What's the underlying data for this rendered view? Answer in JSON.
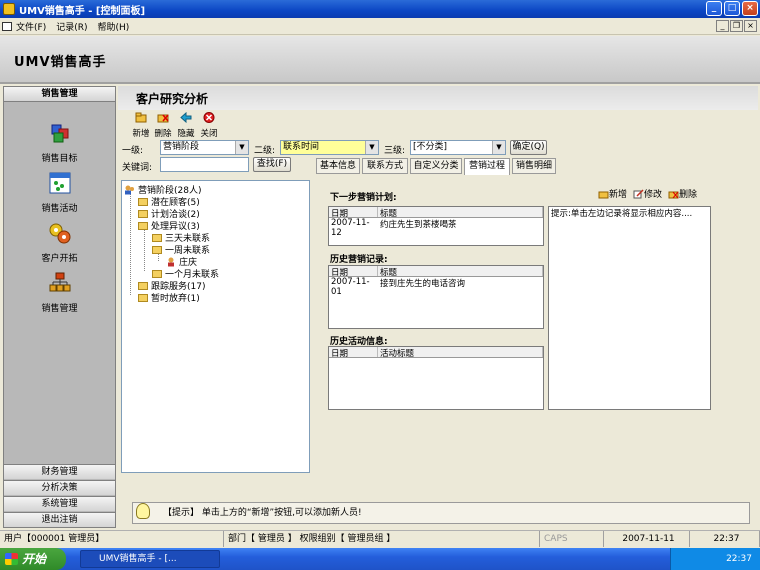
{
  "window": {
    "title": "UMV销售高手 - [控制面板]",
    "min": "_",
    "max": "□",
    "close": "×"
  },
  "menu": [
    "文件(F)",
    "记录(R)",
    "帮助(H)"
  ],
  "mdi": {
    "min": "_",
    "restore": "❐",
    "close": "×"
  },
  "brand": "UMV销售高手",
  "nav": {
    "header": "销售管理",
    "items": [
      "销售目标",
      "销售活动",
      "客户开拓",
      "销售管理"
    ],
    "bottom": [
      "财务管理",
      "分析决策",
      "系统管理",
      "退出注销"
    ]
  },
  "page_title": "客户研究分析",
  "toolbar": {
    "new": "新增",
    "delete": "删除",
    "hide": "隐藏",
    "close": "关闭"
  },
  "filters": {
    "level1_label": "一级:",
    "level1_value": "营销阶段",
    "level2_label": "二级:",
    "level2_value": "联系时间",
    "level3_label": "三级:",
    "level3_value": "[不分类]",
    "ok": "确定(Q)",
    "keyword_label": "关键词:",
    "keyword_value": "",
    "search": "查找(F)"
  },
  "tabs": [
    "基本信息",
    "联系方式",
    "自定义分类",
    "营销过程",
    "销售明细"
  ],
  "tree": [
    {
      "label": "营销阶段(28人)",
      "depth": 0
    },
    {
      "label": "潜在顾客(5)",
      "depth": 1
    },
    {
      "label": "计划洽谈(2)",
      "depth": 1
    },
    {
      "label": "处理异议(3)",
      "depth": 1
    },
    {
      "label": "三天未联系",
      "depth": 2
    },
    {
      "label": "一周未联系",
      "depth": 2
    },
    {
      "label": "庄庆",
      "depth": 3
    },
    {
      "label": "一个月未联系",
      "depth": 2
    },
    {
      "label": "跟踪服务(17)",
      "depth": 1
    },
    {
      "label": "暂时放弃(1)",
      "depth": 1
    }
  ],
  "actions": {
    "new": "新增",
    "edit": "修改",
    "delete": "删除"
  },
  "next_plan": {
    "title": "下一步营销计划:",
    "cols": [
      "日期",
      "标题"
    ],
    "rows": [
      [
        "2007-11-12",
        "约庄先生到茶楼喝茶"
      ]
    ]
  },
  "history": {
    "title": "历史营销记录:",
    "cols": [
      "日期",
      "标题"
    ],
    "rows": [
      [
        "2007-11-01",
        "接到庄先生的电话咨询"
      ]
    ]
  },
  "activity": {
    "title": "历史活动信息:",
    "cols": [
      "日期",
      "活动标题"
    ],
    "rows": []
  },
  "hint_text": "提示:单击左边记录将显示相应内容....",
  "tip": "【提示】 单击上方的“新增”按钮,可以添加新人员!",
  "status": {
    "user": "用户【000001 管理员】",
    "dept": "部门【 管理员 】 权限组别【 管理员组 】",
    "caps": "CAPS",
    "date": "2007-11-11",
    "time": "22:37"
  },
  "taskbar": {
    "start": "开始",
    "task": "UMV销售高手 - [...",
    "clock": "22:37"
  },
  "colors": {
    "titlebar": "#0b46c4",
    "highlight": "#ffff99",
    "taskbar": "#245edb"
  }
}
